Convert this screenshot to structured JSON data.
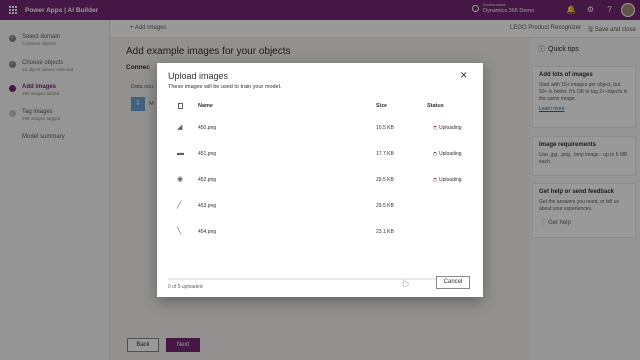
{
  "topbar": {
    "app_title": "Power Apps  |  AI Builder",
    "env_label": "Environment",
    "env_name": "Dynamics 365 Demo",
    "icons": [
      "environment-icon",
      "bell-icon",
      "gear-icon",
      "help-icon",
      "avatar"
    ]
  },
  "nav": {
    "steps": [
      {
        "label": "Select domain",
        "sub": "Common objects",
        "state": "done"
      },
      {
        "label": "Choose objects",
        "sub": "16 object names selected",
        "state": "done"
      },
      {
        "label": "Add images",
        "sub": "299 images added",
        "state": "current"
      },
      {
        "label": "Tag images",
        "sub": "299 images tagged",
        "state": "pending"
      },
      {
        "label": "Model summary",
        "sub": "",
        "state": "none"
      }
    ]
  },
  "cmdbar": {
    "add_images": "Add images",
    "model_name": "LEGO Product Recognizer",
    "save_close": "Save and close"
  },
  "main": {
    "title": "Add example images for your objects",
    "subtitle": "Connec",
    "data_source_label": "Data sou",
    "data_source_tile": "M"
  },
  "footer": {
    "back": "Back",
    "next": "Next"
  },
  "tips": {
    "title": "Quick tips",
    "cards": [
      {
        "head": "Add lots of images",
        "body": "Start with 15+ images per object, but 50+ is better. It's OK to tag 2+ objects in the same image.",
        "link": "Learn more"
      },
      {
        "head": "Image requirements",
        "body": "Use .jpg, .png, .bmp image - up to 6 MB each."
      },
      {
        "head": "Get help or send feedback",
        "body": "Get the answers you need, or tell us about your experiences.",
        "link": "Get help"
      }
    ]
  },
  "dialog": {
    "title": "Upload images",
    "subtitle": "These images will be used to train your model.",
    "columns": {
      "name": "Name",
      "size": "Size",
      "status": "Status"
    },
    "files": [
      {
        "name": "450.png",
        "size": "10.5 KB",
        "status": "Uploading",
        "icon": "brick-thumbnail-icon"
      },
      {
        "name": "451.png",
        "size": "17.7 KB",
        "status": "Uploading",
        "icon": "brick-thumbnail-icon"
      },
      {
        "name": "452.png",
        "size": "29.5 KB",
        "status": "Uploading",
        "icon": "wheel-thumbnail-icon"
      },
      {
        "name": "453.png",
        "size": "29.5 KB",
        "status": "",
        "icon": "rod-thumbnail-icon"
      },
      {
        "name": "454.png",
        "size": "23.1 KB",
        "status": "",
        "icon": "rod-thumbnail-icon"
      }
    ],
    "progress_fraction": 0.0,
    "count_text": "0 of 5 uploaded",
    "cancel": "Cancel",
    "accent": "#742774"
  }
}
